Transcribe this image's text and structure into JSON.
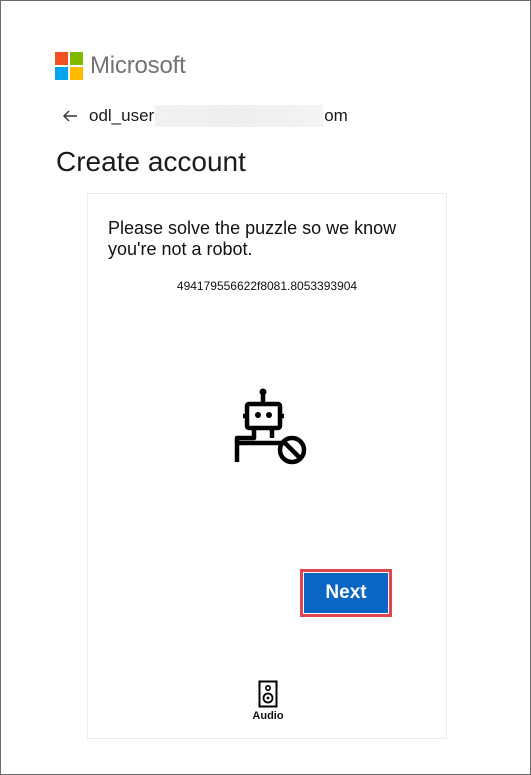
{
  "colors": {
    "ms_red": "#f25022",
    "ms_green": "#7fba00",
    "ms_blue": "#00a4ef",
    "ms_yellow": "#ffb900",
    "accent": "#0a66c2",
    "highlight": "#e0444e"
  },
  "brand": {
    "name": "Microsoft"
  },
  "account": {
    "email_prefix": "odl_user",
    "email_suffix": "om",
    "back_icon": "arrow-left-icon"
  },
  "page": {
    "title": "Create account"
  },
  "puzzle": {
    "prompt": "Please solve the puzzle so we know you're not a robot.",
    "session_id": "494179556622f8081.8053393904",
    "icon": "robot-blocked-icon",
    "next_label": "Next",
    "audio_label": "Audio",
    "audio_icon": "speaker-icon"
  }
}
